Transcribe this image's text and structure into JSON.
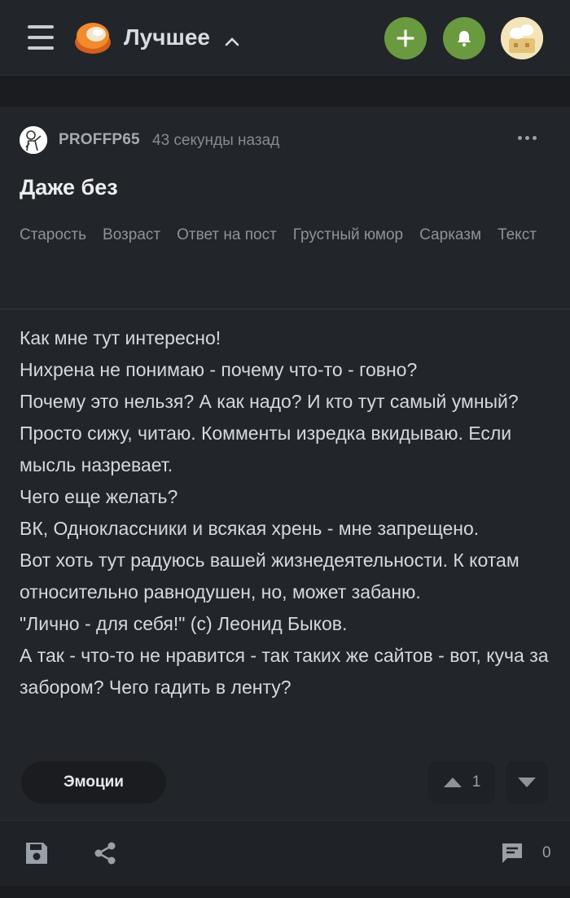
{
  "header": {
    "feed_title": "Лучшее",
    "icons": {
      "menu": "menu-icon",
      "logo": "pikabu-logo",
      "add": "plus-icon",
      "notifications": "bell-icon",
      "avatar": "user-avatar"
    },
    "colors": {
      "accent": "#6a9a3f",
      "background": "#22252a"
    }
  },
  "post": {
    "author": "PROFFP65",
    "time": "43 секунды назад",
    "title": "Даже без",
    "tags": [
      "Старость",
      "Возраст",
      "Ответ на пост",
      "Грустный юмор",
      "Сарказм",
      "Текст"
    ],
    "body_lines": [
      "Как мне тут интересно!",
      "Нихрена не понимаю - почему что-то - говно?",
      "Почему это нельзя? А как надо? И кто тут самый умный?",
      "Просто сижу, читаю. Комменты изредка вкидываю. Если мысль назревает.",
      "Чего еще желать?",
      "ВК, Одноклассники и всякая хрень - мне запрещено.",
      "Вот хоть тут радуюсь вашей жизнедеятельности. К котам относительно равнодушен, но, может забаню.",
      "\"Лично - для себя!\" (с) Леонид Быков.",
      "А так - что-то не нравится - так таких же сайтов - вот, куча за забором? Чего гадить в ленту?"
    ],
    "emotions_label": "Эмоции",
    "rating": "1",
    "comments_count": "0"
  }
}
